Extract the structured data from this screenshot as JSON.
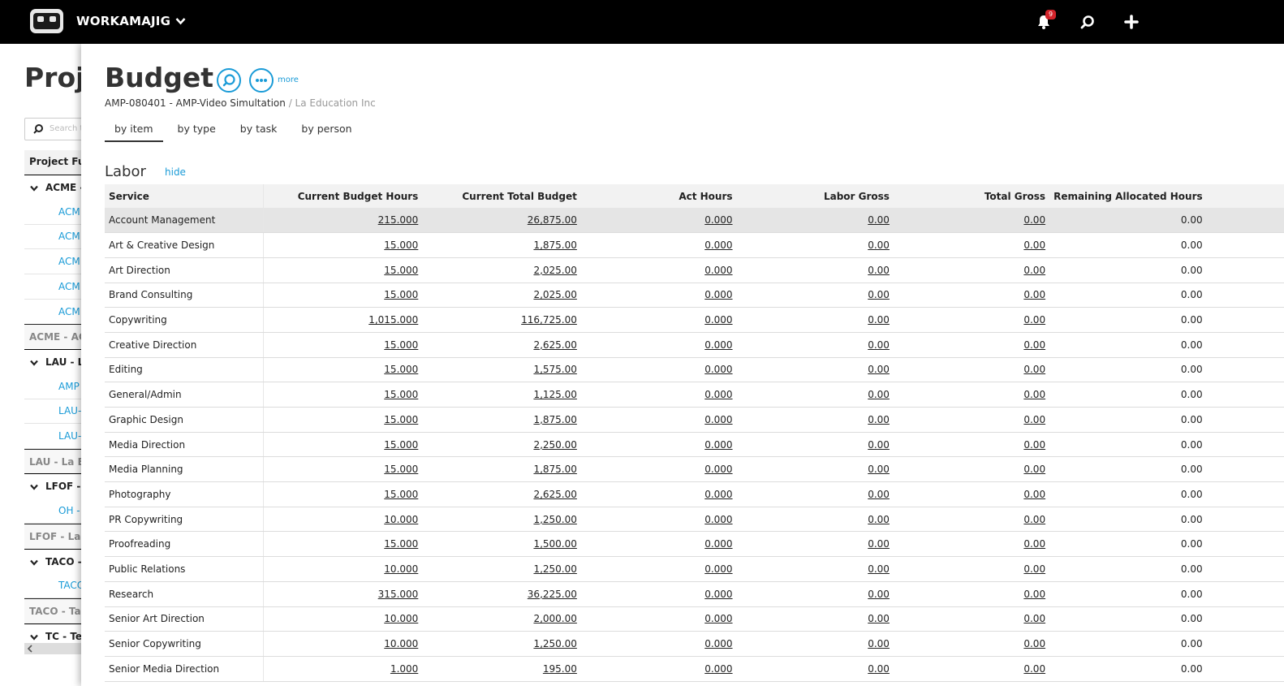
{
  "app": {
    "brand": "WORKAMAJIG",
    "notification_count": "9",
    "icons": [
      "robot-logo-icon",
      "chevron-down-icon",
      "bell-icon",
      "search-icon",
      "plus-icon"
    ]
  },
  "background_page": {
    "title": "Proje",
    "search_placeholder": "Search t",
    "column_header": "Project Ful",
    "rows": [
      {
        "type": "group",
        "text": "ACME -"
      },
      {
        "type": "child",
        "text": "ACM"
      },
      {
        "type": "child",
        "text": "ACM"
      },
      {
        "type": "child",
        "text": "ACM"
      },
      {
        "type": "child",
        "text": "ACM"
      },
      {
        "type": "child",
        "text": "ACM"
      },
      {
        "type": "summary",
        "text": "ACME - ACM"
      },
      {
        "type": "group",
        "text": "LAU - La"
      },
      {
        "type": "child",
        "text": "AMP"
      },
      {
        "type": "child",
        "text": "LAU-"
      },
      {
        "type": "child",
        "text": "LAU-"
      },
      {
        "type": "summary",
        "text": "LAU - La Ed"
      },
      {
        "type": "group",
        "text": "LFOF - L"
      },
      {
        "type": "child",
        "text": "OH -"
      },
      {
        "type": "summary",
        "text": "LFOF - Last"
      },
      {
        "type": "group",
        "text": "TACO -"
      },
      {
        "type": "child",
        "text": "TACO"
      },
      {
        "type": "summary",
        "text": "TACO - Tac"
      },
      {
        "type": "group",
        "text": "TC - Tes"
      }
    ]
  },
  "panel": {
    "title": "Budget",
    "more_label": "more",
    "project": "AMP-080401 - AMP-Video Simultation",
    "client": "/ La Education Inc",
    "tabs": [
      {
        "label": "by item",
        "active": true
      },
      {
        "label": "by type",
        "active": false
      },
      {
        "label": "by task",
        "active": false
      },
      {
        "label": "by person",
        "active": false
      }
    ],
    "section": {
      "title": "Labor",
      "hide_label": "hide"
    },
    "table": {
      "columns": [
        "Service",
        "Current Budget Hours",
        "Current Total Budget",
        "Act Hours",
        "Labor Gross",
        "Total Gross",
        "Remaining Allocated Hours"
      ],
      "rows": [
        [
          "Account Management",
          "215.000",
          "26,875.00",
          "0.000",
          "0.00",
          "0.00",
          "0.00"
        ],
        [
          "Art & Creative Design",
          "15.000",
          "1,875.00",
          "0.000",
          "0.00",
          "0.00",
          "0.00"
        ],
        [
          "Art Direction",
          "15.000",
          "2,025.00",
          "0.000",
          "0.00",
          "0.00",
          "0.00"
        ],
        [
          "Brand Consulting",
          "15.000",
          "2,025.00",
          "0.000",
          "0.00",
          "0.00",
          "0.00"
        ],
        [
          "Copywriting",
          "1,015.000",
          "116,725.00",
          "0.000",
          "0.00",
          "0.00",
          "0.00"
        ],
        [
          "Creative Direction",
          "15.000",
          "2,625.00",
          "0.000",
          "0.00",
          "0.00",
          "0.00"
        ],
        [
          "Editing",
          "15.000",
          "1,575.00",
          "0.000",
          "0.00",
          "0.00",
          "0.00"
        ],
        [
          "General/Admin",
          "15.000",
          "1,125.00",
          "0.000",
          "0.00",
          "0.00",
          "0.00"
        ],
        [
          "Graphic Design",
          "15.000",
          "1,875.00",
          "0.000",
          "0.00",
          "0.00",
          "0.00"
        ],
        [
          "Media Direction",
          "15.000",
          "2,250.00",
          "0.000",
          "0.00",
          "0.00",
          "0.00"
        ],
        [
          "Media Planning",
          "15.000",
          "1,875.00",
          "0.000",
          "0.00",
          "0.00",
          "0.00"
        ],
        [
          "Photography",
          "15.000",
          "2,625.00",
          "0.000",
          "0.00",
          "0.00",
          "0.00"
        ],
        [
          "PR Copywriting",
          "10.000",
          "1,250.00",
          "0.000",
          "0.00",
          "0.00",
          "0.00"
        ],
        [
          "Proofreading",
          "15.000",
          "1,500.00",
          "0.000",
          "0.00",
          "0.00",
          "0.00"
        ],
        [
          "Public Relations",
          "10.000",
          "1,250.00",
          "0.000",
          "0.00",
          "0.00",
          "0.00"
        ],
        [
          "Research",
          "315.000",
          "36,225.00",
          "0.000",
          "0.00",
          "0.00",
          "0.00"
        ],
        [
          "Senior Art Direction",
          "10.000",
          "2,000.00",
          "0.000",
          "0.00",
          "0.00",
          "0.00"
        ],
        [
          "Senior Copywriting",
          "10.000",
          "1,250.00",
          "0.000",
          "0.00",
          "0.00",
          "0.00"
        ],
        [
          "Senior Media Direction",
          "1.000",
          "195.00",
          "0.000",
          "0.00",
          "0.00",
          "0.00"
        ]
      ]
    }
  },
  "colors": {
    "accent": "#1a9bd7",
    "topbar": "#000000",
    "badge": "#d2232a",
    "row_highlight": "#e5e5e5"
  }
}
